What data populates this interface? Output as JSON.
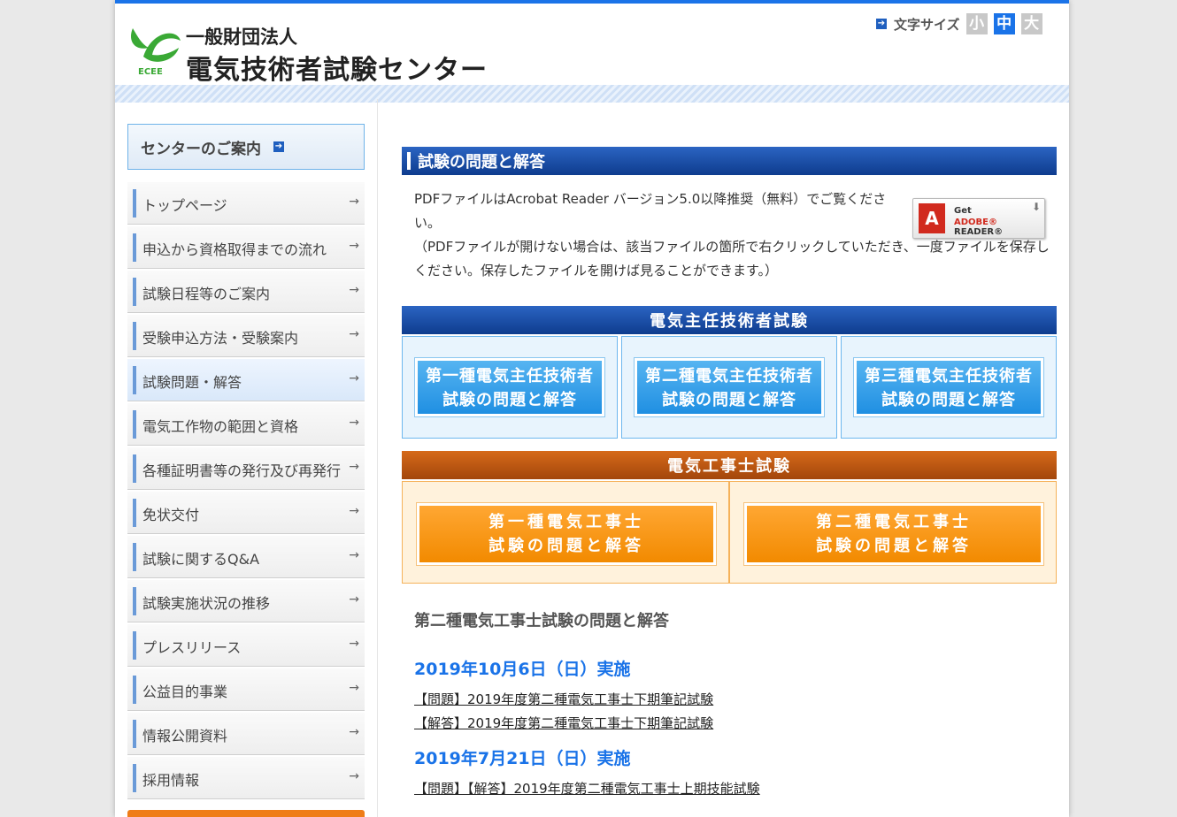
{
  "header": {
    "org_type": "一般財団法人",
    "org_name": "電気技術者試験センター",
    "logo_letters": "ECEE",
    "font_size_label": "文字サイズ",
    "font_sizes": [
      "小",
      "中",
      "大"
    ],
    "font_size_colors": [
      "#c8c8c8",
      "#1a73e8",
      "#c8c8c8"
    ]
  },
  "sidebar": {
    "heading": "センターのご案内",
    "items": [
      {
        "label": "トップページ"
      },
      {
        "label": "申込から資格取得までの流れ"
      },
      {
        "label": "試験日程等のご案内"
      },
      {
        "label": "受験申込方法・受験案内"
      },
      {
        "label": "試験問題・解答"
      },
      {
        "label": "電気工作物の範囲と資格"
      },
      {
        "label": "各種証明書等の発行及び再発行"
      },
      {
        "label": "免状交付"
      },
      {
        "label": "試験に関するQ&A"
      },
      {
        "label": "試験実施状況の推移"
      },
      {
        "label": "プレスリリース"
      },
      {
        "label": "公益目的事業"
      },
      {
        "label": "情報公開資料"
      },
      {
        "label": "採用情報"
      }
    ],
    "active_item": "試験問題・解答"
  },
  "main": {
    "section_title": "試験の問題と解答",
    "pdf_note_line1": "PDFファイルはAcrobat Reader バージョン5.0以降推奨（無料）でご覧ください。",
    "pdf_note_line2": "（PDFファイルが開けない場合は、該当ファイルの箇所で右クリックしていただき、一度ファイルを保存しください。保存したファイルを開けば見ることができます。）",
    "adobe_badge": {
      "get": "Get",
      "brand": "ADOBE®",
      "product": "READER®"
    },
    "chief_band": "電気主任技術者試験",
    "chief_buttons": [
      {
        "line1": "第一種電気主任技術者",
        "line2": "試験の問題と解答"
      },
      {
        "line1": "第二種電気主任技術者",
        "line2": "試験の問題と解答"
      },
      {
        "line1": "第三種電気主任技術者",
        "line2": "試験の問題と解答"
      }
    ],
    "electrician_band": "電気工事士試験",
    "electrician_buttons": [
      {
        "line1": "第一種電気工事士",
        "line2": "試験の問題と解答"
      },
      {
        "line1": "第二種電気工事士",
        "line2": "試験の問題と解答"
      }
    ],
    "subsection_title": "第二種電気工事士試験の問題と解答",
    "exams": [
      {
        "date": "2019年10月6日（日）実施",
        "links": [
          "【問題】2019年度第二種電気工事士下期筆記試験",
          "【解答】2019年度第二種電気工事士下期筆記試験"
        ]
      },
      {
        "date": "2019年7月21日（日）実施",
        "links": [
          "【問題】【解答】2019年度第二種電気工事士上期技能試験"
        ]
      }
    ]
  },
  "colors": {
    "brand_blue": "#1a73e8",
    "navy": "#0e3c8e",
    "orange": "#f28a00",
    "logo_green": "#3aa935"
  }
}
